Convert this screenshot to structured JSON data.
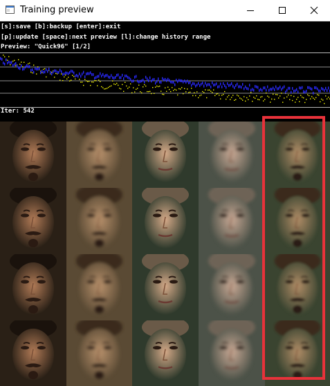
{
  "window": {
    "title": "Training preview",
    "icon": "app-window-icon",
    "controls": [
      "minimize-icon",
      "maximize-icon",
      "close-icon"
    ]
  },
  "help": {
    "line1": "[s]:save [b]:backup [enter]:exit",
    "line2": "[p]:update [space]:next preview [l]:change history range",
    "preview_label": "Preview: \"Quick96\" [1/2]"
  },
  "loss_graph": {
    "series": [
      {
        "color": "#ffff00",
        "trend": [
          0.92,
          0.72,
          0.55,
          0.44,
          0.36,
          0.3,
          0.26,
          0.22,
          0.19,
          0.17,
          0.14
        ]
      },
      {
        "color": "#2a2aff",
        "trend": [
          0.88,
          0.72,
          0.66,
          0.6,
          0.55,
          0.5,
          0.45,
          0.41,
          0.37,
          0.34,
          0.33
        ]
      }
    ]
  },
  "iter_label": "Iter: 542",
  "preview_grid": {
    "highlight_color": "#e8323a",
    "columns": [
      "source-face",
      "source-reconstruction",
      "destination-face",
      "destination-reconstruction",
      "swapped-face"
    ]
  }
}
